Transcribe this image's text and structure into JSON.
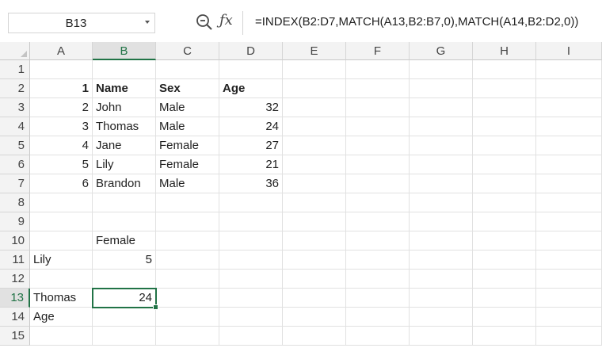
{
  "name_box": "B13",
  "formula": "=INDEX(B2:D7,MATCH(A13,B2:B7,0),MATCH(A14,B2:D2,0))",
  "selected_cell": "B13",
  "columns": [
    "A",
    "B",
    "C",
    "D",
    "E",
    "F",
    "G",
    "H",
    "I"
  ],
  "rows": [
    "1",
    "2",
    "3",
    "4",
    "5",
    "6",
    "7",
    "8",
    "9",
    "10",
    "11",
    "12",
    "13",
    "14",
    "15"
  ],
  "cells": {
    "r2": {
      "A": "1",
      "B": "Name",
      "C": "Sex",
      "D": "Age"
    },
    "r3": {
      "A": "2",
      "B": "John",
      "C": "Male",
      "D": "32"
    },
    "r4": {
      "A": "3",
      "B": "Thomas",
      "C": "Male",
      "D": "24"
    },
    "r5": {
      "A": "4",
      "B": "Jane",
      "C": "Female",
      "D": "27"
    },
    "r6": {
      "A": "5",
      "B": "Lily",
      "C": "Female",
      "D": "21"
    },
    "r7": {
      "A": "6",
      "B": "Brandon",
      "C": "Male",
      "D": "36"
    },
    "r10": {
      "B": "Female"
    },
    "r11": {
      "A": "Lily",
      "B": "5"
    },
    "r13": {
      "A": "Thomas",
      "B": "24"
    },
    "r14": {
      "A": "Age"
    }
  },
  "colors": {
    "accent": "#217346",
    "header_bg": "#f3f3f3",
    "selected_header_bg": "#e1e1e1",
    "gridline": "#e1e1e1"
  },
  "icons": {
    "zoom": "zoom-icon",
    "function": "fx-icon",
    "dropdown": "chevron-down-icon"
  }
}
